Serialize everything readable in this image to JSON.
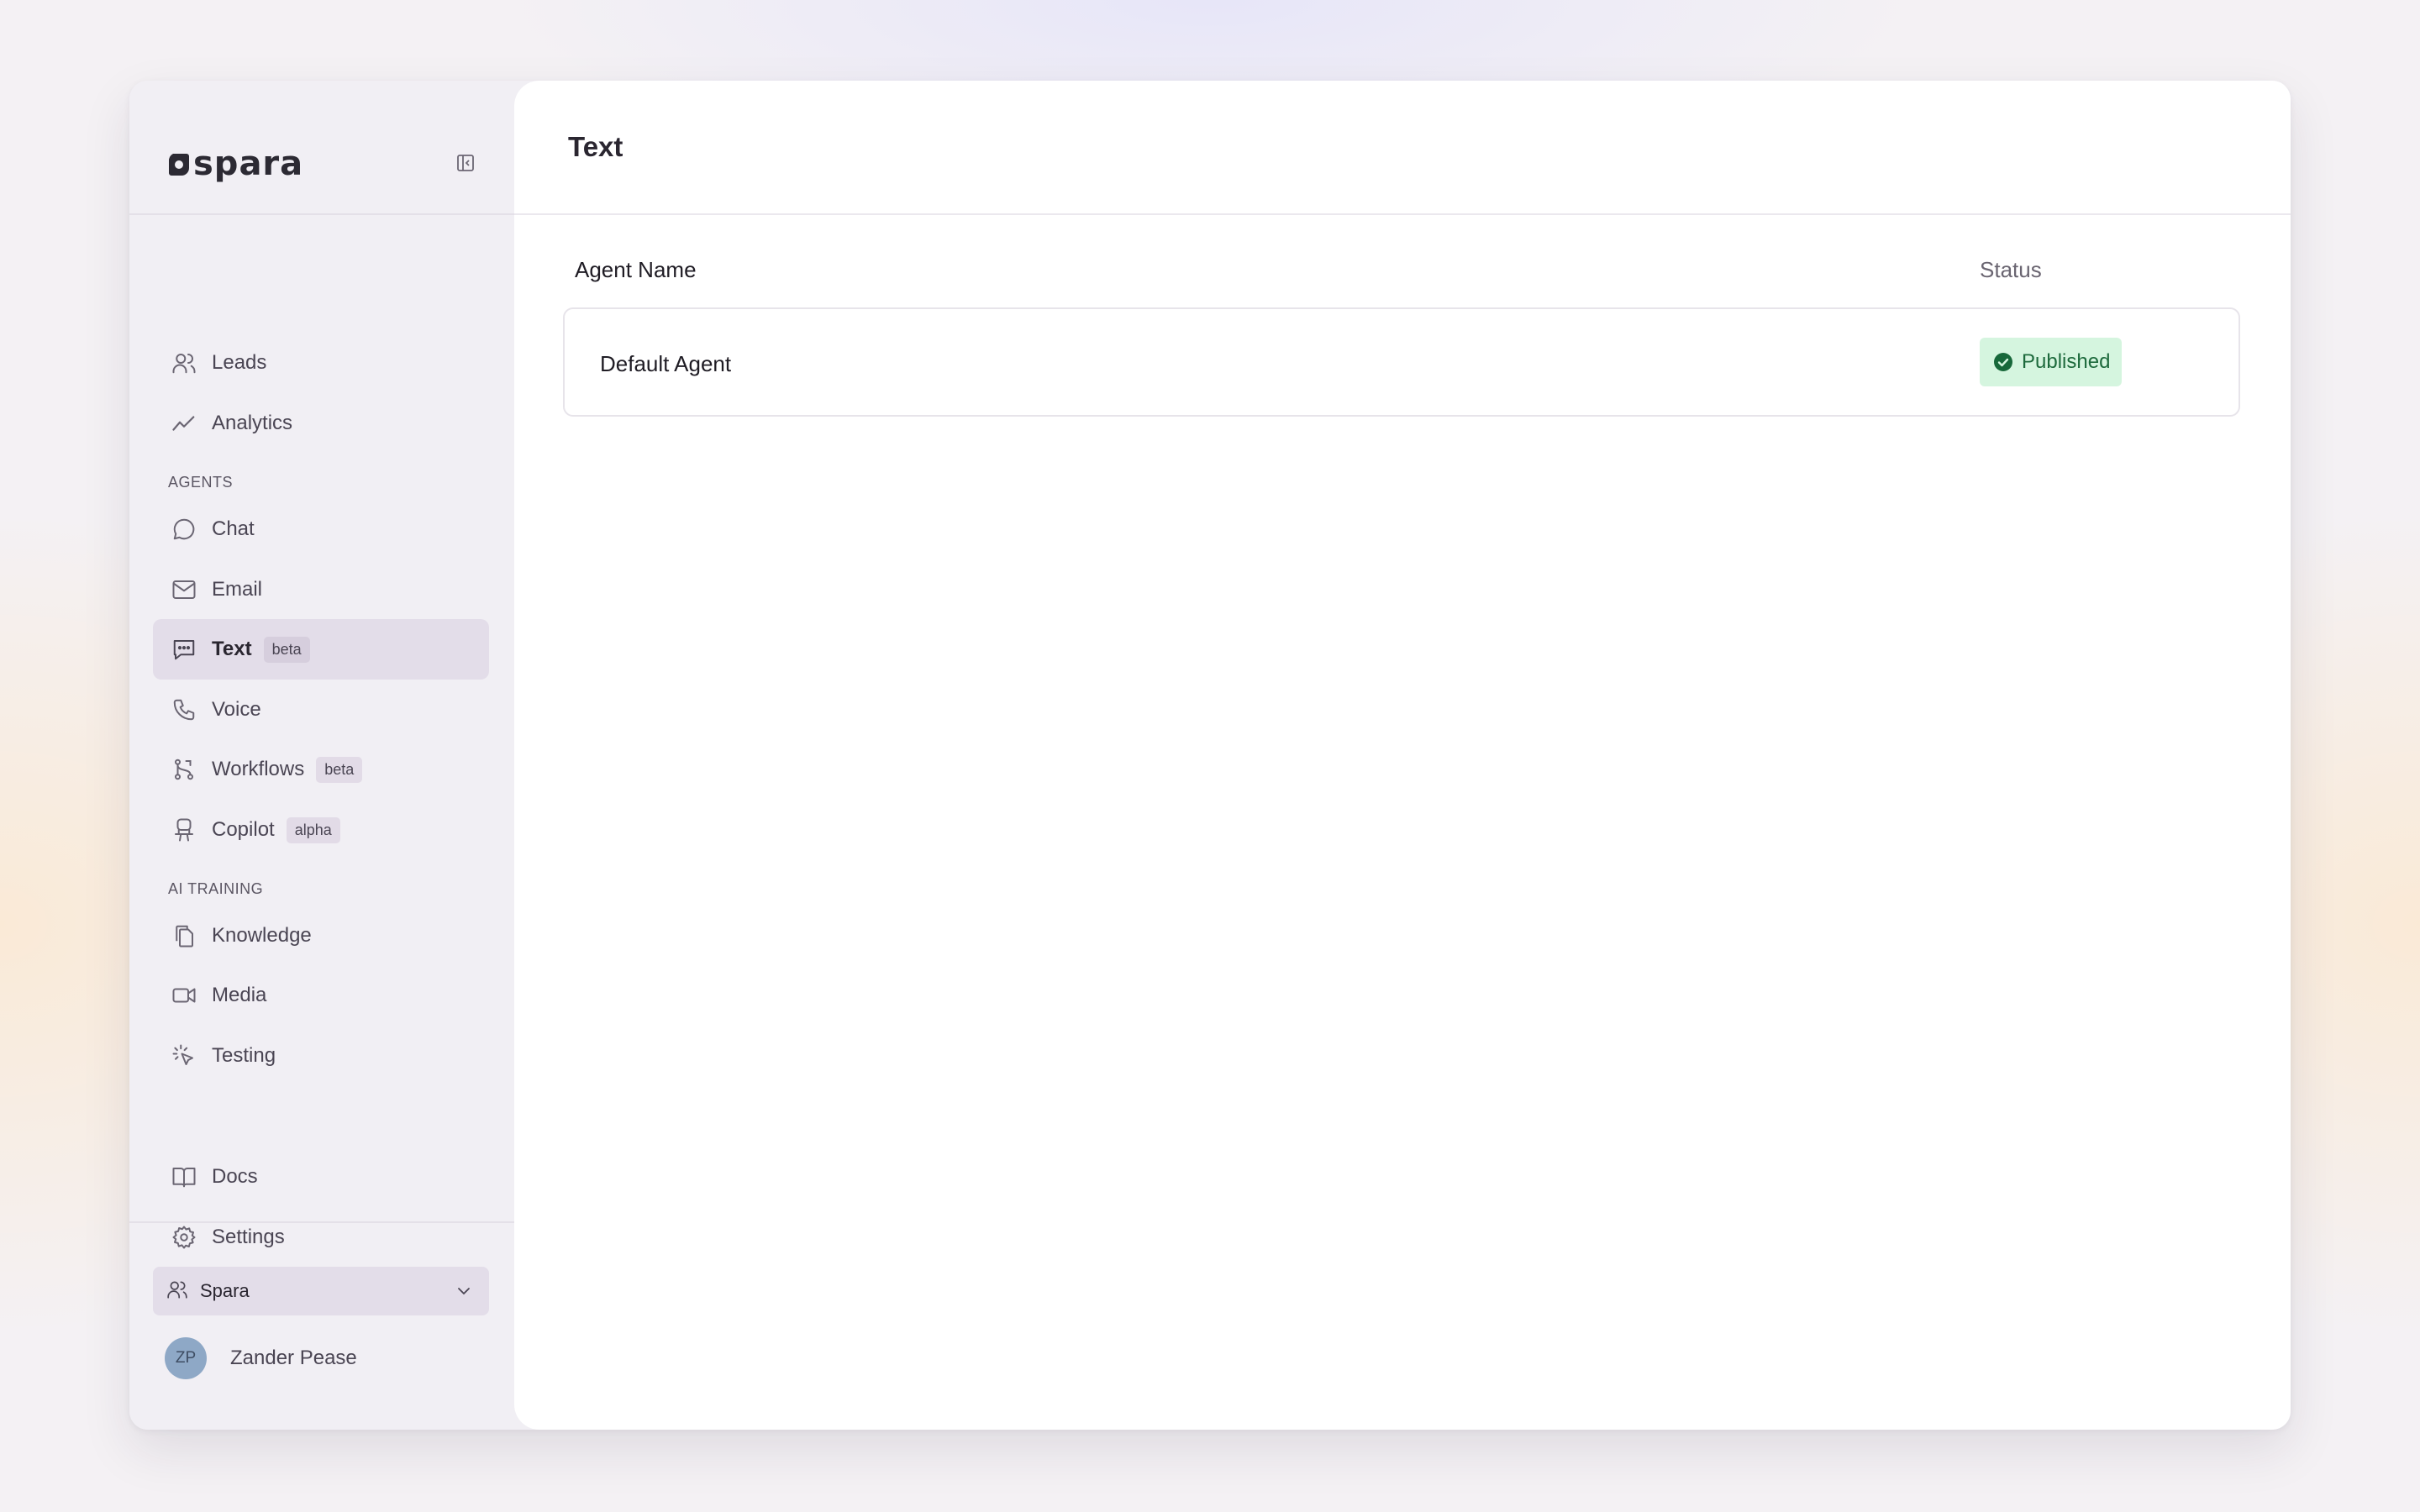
{
  "sidebar": {
    "brand": "spara",
    "items_top": [
      {
        "label": "Leads",
        "icon": "users-icon"
      },
      {
        "label": "Analytics",
        "icon": "trend-icon"
      }
    ],
    "section_agents": "AGENTS",
    "items_agents": [
      {
        "label": "Chat",
        "icon": "chat-bubble-icon",
        "badge": ""
      },
      {
        "label": "Email",
        "icon": "mail-icon",
        "badge": ""
      },
      {
        "label": "Text",
        "icon": "sms-icon",
        "badge": "beta",
        "active": true
      },
      {
        "label": "Voice",
        "icon": "phone-icon",
        "badge": ""
      },
      {
        "label": "Workflows",
        "icon": "git-branch-icon",
        "badge": "beta"
      },
      {
        "label": "Copilot",
        "icon": "copilot-icon",
        "badge": "alpha"
      }
    ],
    "section_training": "AI TRAINING",
    "items_training": [
      {
        "label": "Knowledge",
        "icon": "files-icon"
      },
      {
        "label": "Media",
        "icon": "video-icon"
      },
      {
        "label": "Testing",
        "icon": "click-icon"
      }
    ],
    "items_bottom": [
      {
        "label": "Docs",
        "icon": "book-icon"
      },
      {
        "label": "Settings",
        "icon": "gear-icon"
      }
    ],
    "workspace": "Spara",
    "user": {
      "initials": "ZP",
      "name": "Zander Pease"
    }
  },
  "main": {
    "title": "Text",
    "columns": {
      "name": "Agent Name",
      "status": "Status"
    },
    "rows": [
      {
        "name": "Default Agent",
        "status": "Published"
      }
    ]
  },
  "colors": {
    "active_bg": "#e3dde9",
    "published_bg": "#d5f5df",
    "published_text": "#1d6a3c"
  }
}
